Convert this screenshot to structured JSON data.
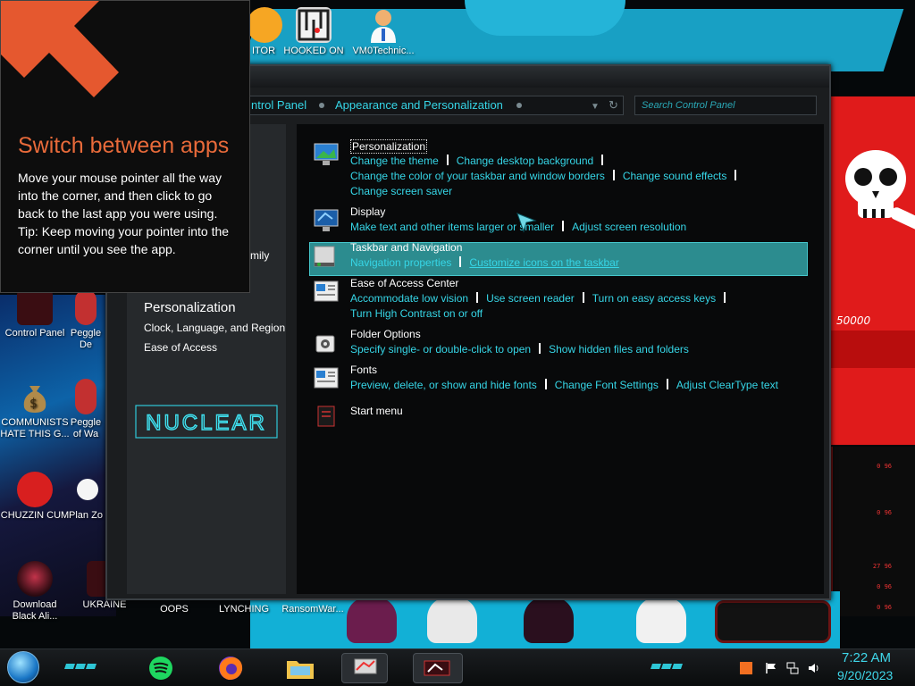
{
  "desktop": {
    "top_icons": [
      {
        "label": "ITOR",
        "icon": "app-icon"
      },
      {
        "label": "HOOKED ON",
        "icon": "maze-icon"
      },
      {
        "label": "VM0Technic...",
        "icon": "doctor-icon"
      }
    ],
    "left_icons": [
      {
        "label": "Control Panel",
        "icon": "control-panel-icon"
      },
      {
        "label": "Peggle De",
        "icon": "peggle-icon"
      },
      {
        "label": "COMMUNISTS HATE THIS G...",
        "icon": "money-bag-icon"
      },
      {
        "label": "Peggle of Wa",
        "icon": "peggle-icon"
      },
      {
        "label": "CHUZZIN CUM",
        "icon": "chuzzle-icon"
      },
      {
        "label": "Plan Zo",
        "icon": "flower-icon"
      },
      {
        "label": "Download Black Ali...",
        "icon": "black-orb-icon"
      },
      {
        "label": "UKRAINE",
        "icon": "app-icon"
      }
    ],
    "bottom_icons": [
      {
        "label": "OOPS"
      },
      {
        "label": "LYNCHING"
      },
      {
        "label": "RansomWar..."
      }
    ],
    "wallpaper_score": "50000",
    "hud_numbers": [
      "0 96",
      "0 96",
      "27 96",
      "0 96",
      "0 96"
    ]
  },
  "charm_hint": {
    "title": "Switch between apps",
    "body": "Move your mouse pointer all the way into the corner, and then click to go back to the last app you were using.",
    "tip": "Tip: Keep moving your pointer into the corner until you see the app."
  },
  "control_panel": {
    "breadcrumb": [
      "ntrol Panel",
      "Appearance and Personalization"
    ],
    "search_placeholder": "Search Control Panel",
    "left_nav": {
      "partial_item": "mily",
      "heading": "Personalization",
      "items": [
        "Clock, Language, and Region",
        "Ease of Access"
      ],
      "logo_text": "NUCLEAR"
    },
    "categories": [
      {
        "title": "Personalization",
        "icon": "personalization-icon",
        "links": [
          "Change the theme",
          "Change desktop background",
          "Change the color of your taskbar and window borders",
          "Change sound effects",
          "Change screen saver"
        ]
      },
      {
        "title": "Display",
        "icon": "display-icon",
        "links": [
          "Make text and other items larger or smaller",
          "Adjust screen resolution"
        ]
      },
      {
        "title": "Taskbar and Navigation",
        "icon": "taskbar-icon",
        "links": [
          "Navigation properties",
          "Customize icons on the taskbar"
        ]
      },
      {
        "title": "Ease of Access Center",
        "icon": "ease-of-access-icon",
        "links": [
          "Accommodate low vision",
          "Use screen reader",
          "Turn on easy access keys",
          "Turn High Contrast on or off"
        ]
      },
      {
        "title": "Folder Options",
        "icon": "folder-options-icon",
        "links": [
          "Specify single- or double-click to open",
          "Show hidden files and folders"
        ]
      },
      {
        "title": "Fonts",
        "icon": "fonts-icon",
        "links": [
          "Preview, delete, or show and hide fonts",
          "Change Font Settings",
          "Adjust ClearType text"
        ]
      },
      {
        "title": "Start menu",
        "icon": "start-menu-icon",
        "links": []
      }
    ]
  },
  "taskbar": {
    "pinned": [
      "spotify-icon",
      "firefox-icon",
      "file-explorer-icon",
      "control-panel-icon",
      "control-panel-icon"
    ],
    "tray": [
      "app-icon",
      "flag-icon",
      "network-icon",
      "volume-icon"
    ],
    "clock_time": "7:22 AM",
    "clock_date": "9/20/2023"
  },
  "colors": {
    "accent": "#36d6e7",
    "charm_title": "#e86a3a",
    "selected_row": "#2c8c8f"
  }
}
